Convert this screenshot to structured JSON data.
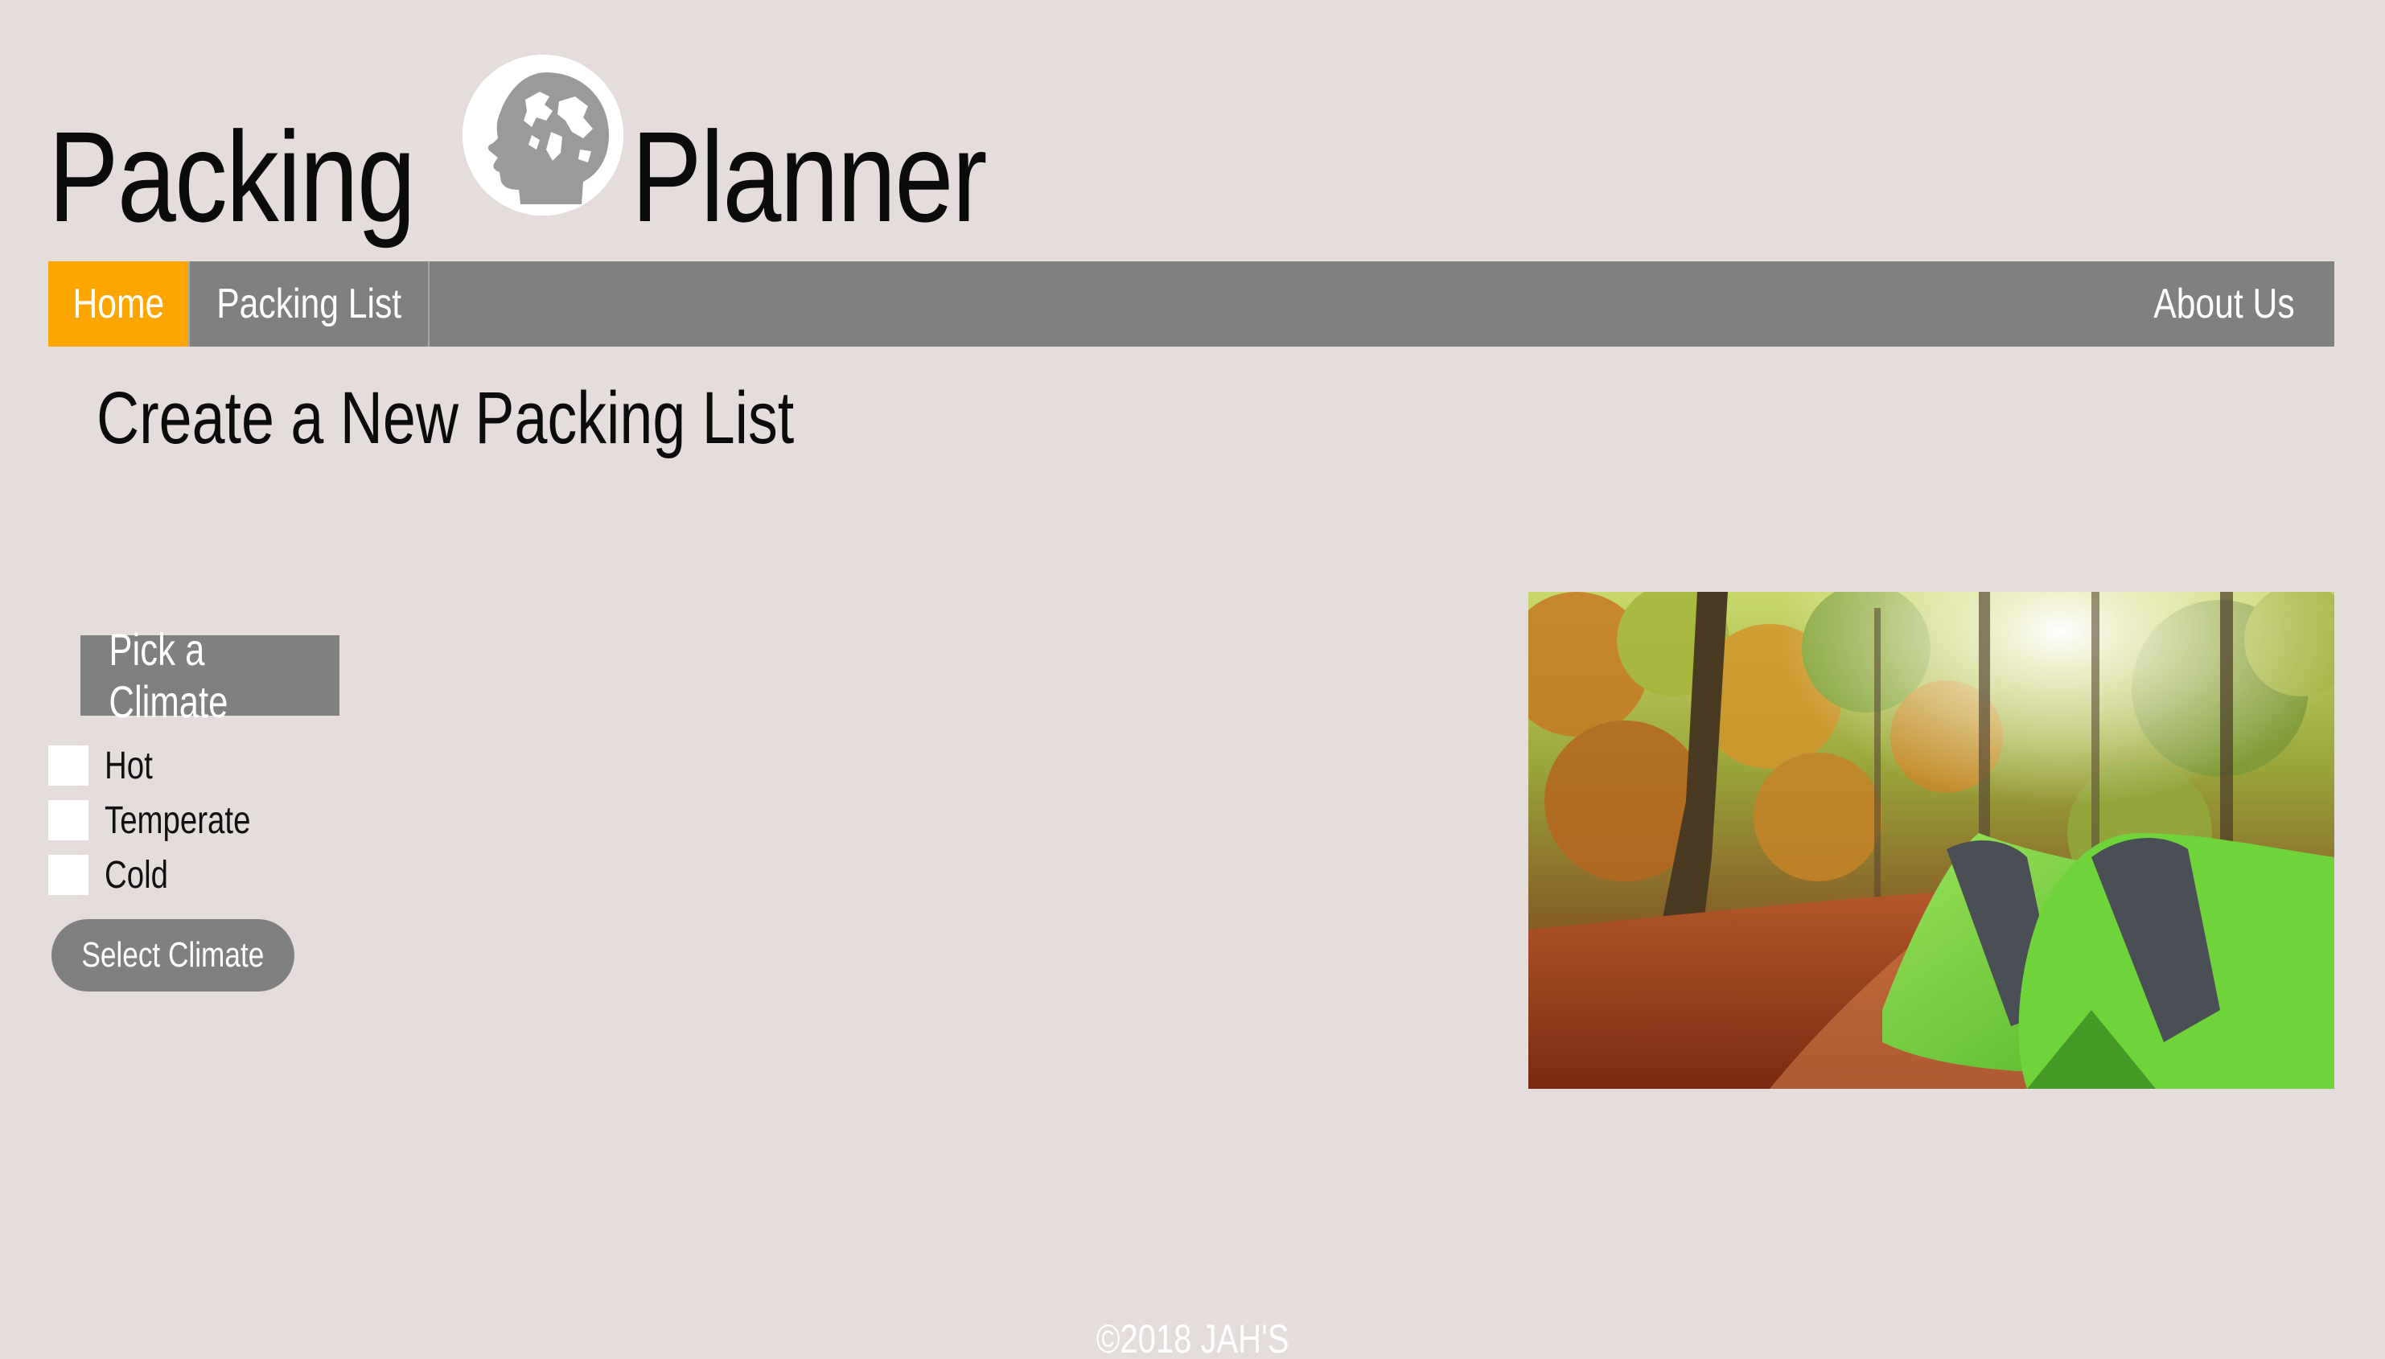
{
  "header": {
    "title_left": "Packing",
    "title_right": "Planner",
    "logo_icon": "globe-head-icon"
  },
  "nav": {
    "items": [
      {
        "label": "Home",
        "active": true
      },
      {
        "label": "Packing List",
        "active": false
      }
    ],
    "right_item": {
      "label": "About Us"
    },
    "accent_color": "#ffa500",
    "bar_color": "#808080"
  },
  "main": {
    "title": "Create a New Packing List"
  },
  "climate": {
    "heading": "Pick a Climate",
    "options": [
      {
        "label": "Hot",
        "checked": false
      },
      {
        "label": "Temperate",
        "checked": false
      },
      {
        "label": "Cold",
        "checked": false
      }
    ],
    "button_label": "Select Climate"
  },
  "photo": {
    "subject": "green tents in autumn forest"
  },
  "footer": {
    "text": "©2018 JAH'S"
  },
  "colors": {
    "background": "#e5dcdc",
    "accent": "#ffa500",
    "gray": "#808080"
  }
}
